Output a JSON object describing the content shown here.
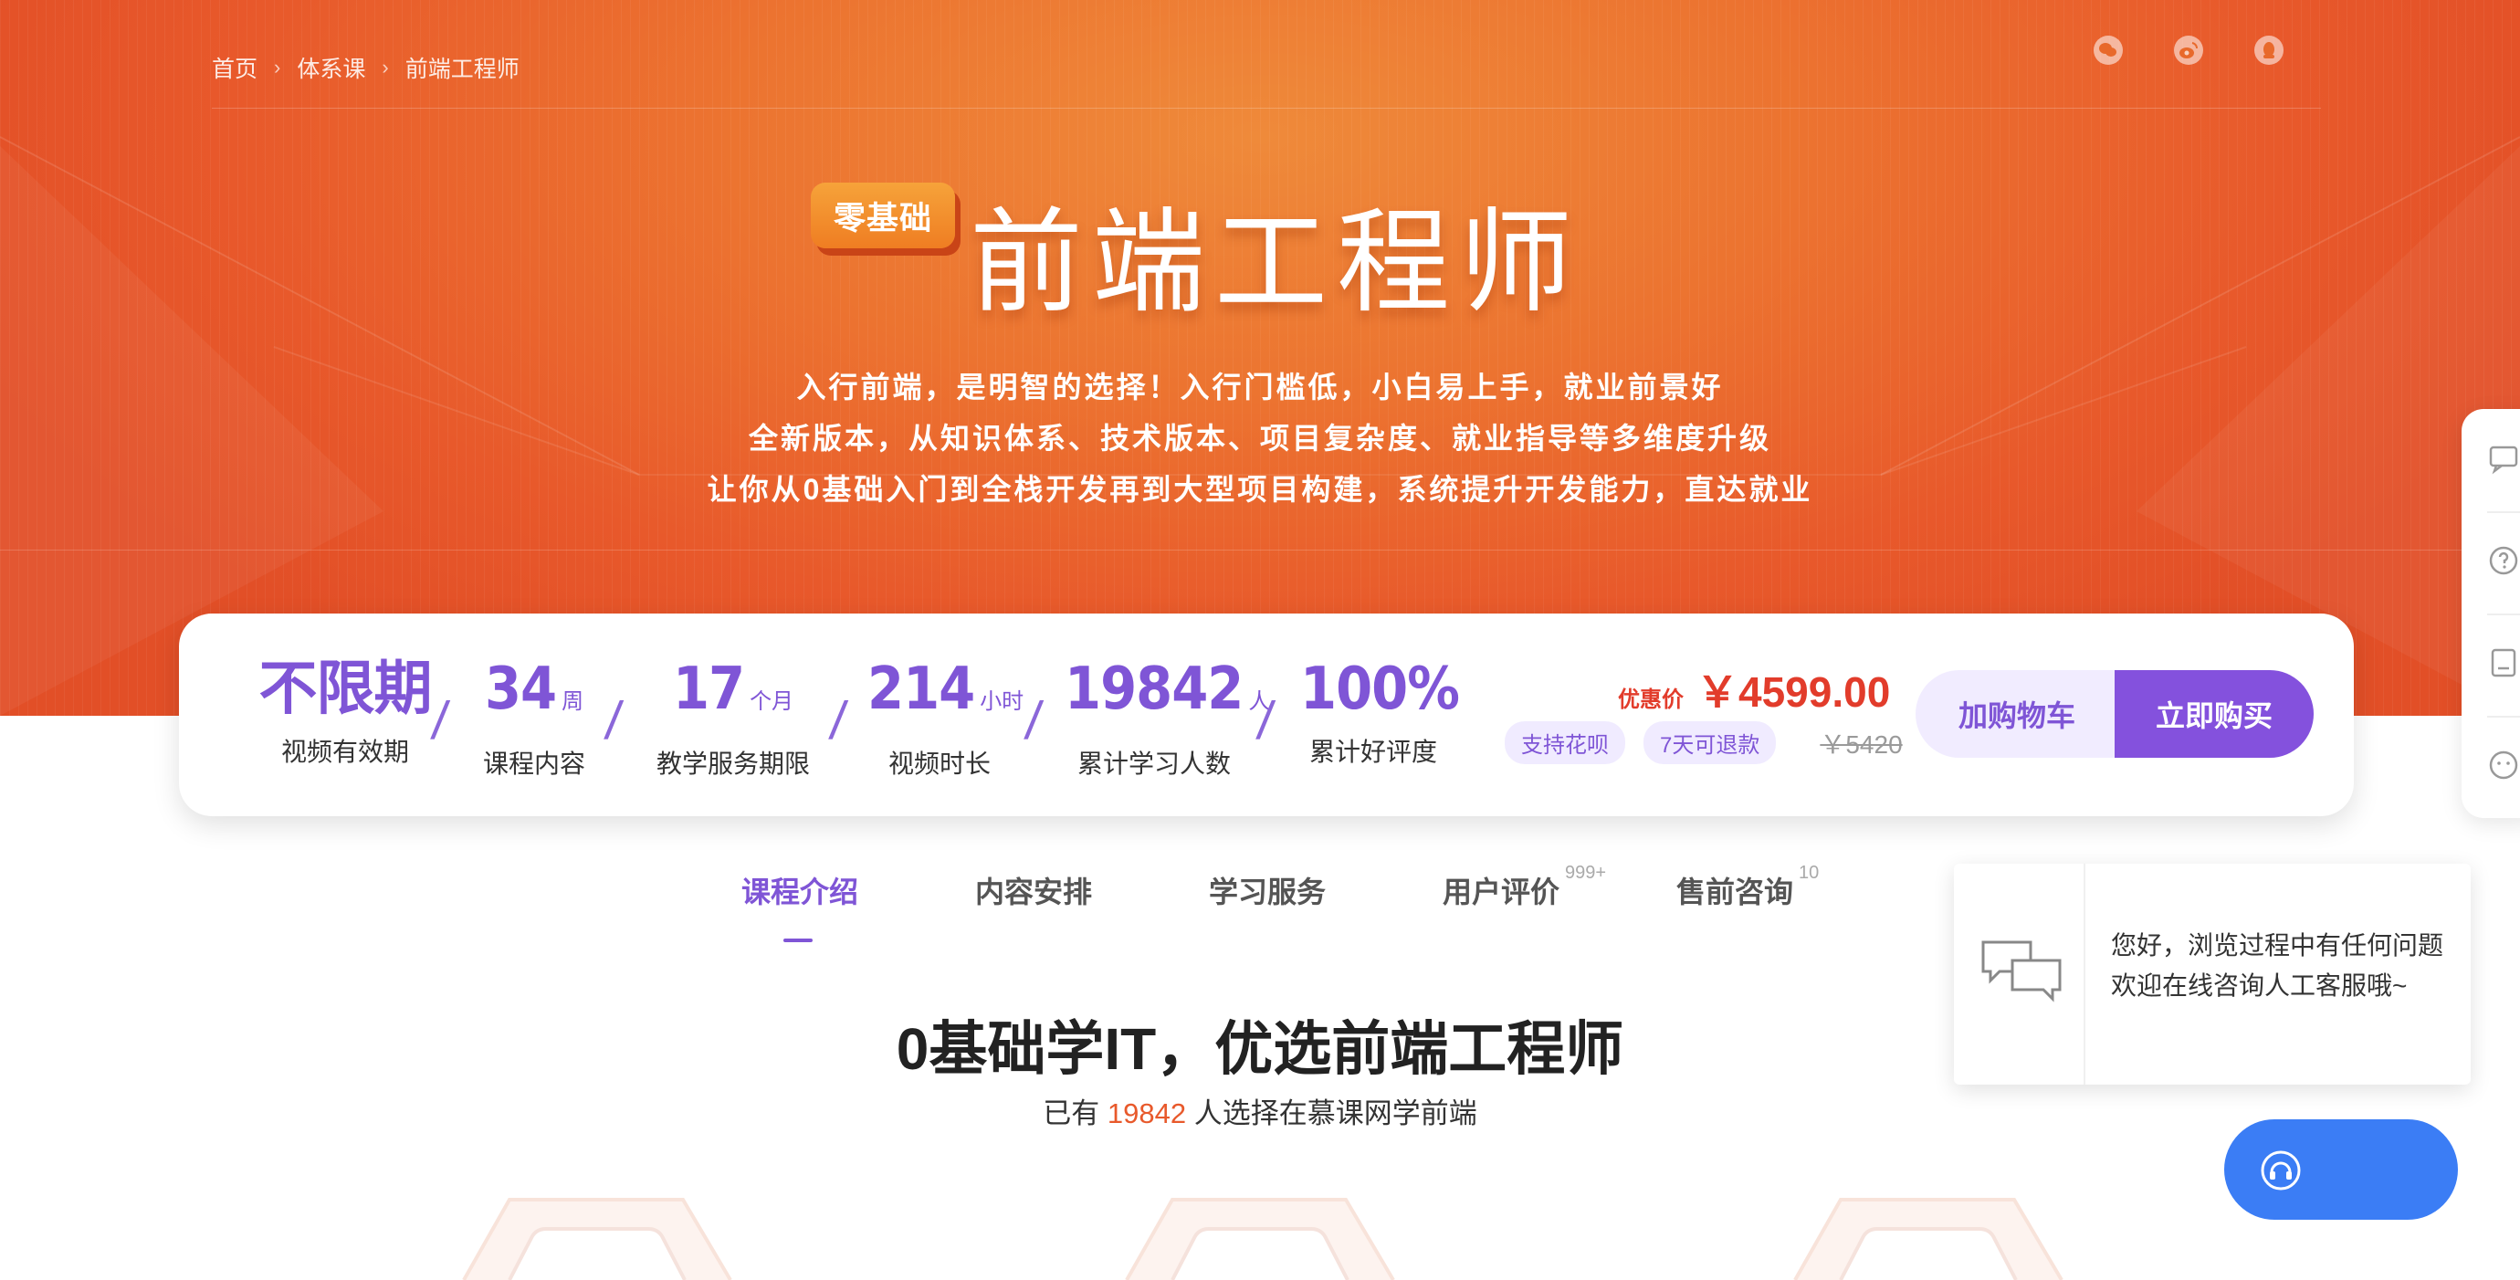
{
  "breadcrumb": {
    "items": [
      "首页",
      "体系课",
      "前端工程师"
    ],
    "separator": "›"
  },
  "hero": {
    "badge": "零基础",
    "title": "前端工程师",
    "lines": [
      "入行前端，是明智的选择！入行门槛低，小白易上手，就业前景好",
      "全新版本，从知识体系、技术版本、项目复杂度、就业指导等多维度升级",
      "让你从0基础入门到全栈开发再到大型项目构建，系统提升开发能力，直达就业"
    ]
  },
  "social_icons": [
    "wechat-icon",
    "weibo-icon",
    "qq-icon"
  ],
  "stats": [
    {
      "value": "不限期",
      "unit": "",
      "label": "视频有效期"
    },
    {
      "value": "34",
      "unit": "周",
      "label": "课程内容"
    },
    {
      "value": "17",
      "unit": "个月",
      "label": "教学服务期限"
    },
    {
      "value": "214",
      "unit": "小时",
      "label": "视频时长"
    },
    {
      "value": "19842",
      "unit": "人",
      "label": "累计学习人数"
    },
    {
      "value": "100%",
      "unit": "",
      "label": "累计好评度"
    }
  ],
  "stats_separator": "/",
  "pricing": {
    "discount_label": "优惠价",
    "price": "￥4599.00",
    "tags": [
      "支持花呗",
      "7天可退款"
    ],
    "original_price": "￥5420"
  },
  "buttons": {
    "add_cart": "加购物车",
    "buy_now": "立即购买"
  },
  "tabs": [
    {
      "label": "课程介绍",
      "badge": ""
    },
    {
      "label": "内容安排",
      "badge": ""
    },
    {
      "label": "学习服务",
      "badge": ""
    },
    {
      "label": "用户评价",
      "badge": "999+"
    },
    {
      "label": "售前咨询",
      "badge": "10"
    }
  ],
  "active_tab": "课程介绍",
  "section": {
    "title": "0基础学IT，优选前端工程师",
    "sub_prefix": "已有",
    "sub_count": "19842",
    "sub_suffix": "人选择在慕课网学前端"
  },
  "side_rail_icons": [
    "message-icon",
    "help-icon",
    "notes-icon",
    "feedback-icon"
  ],
  "chat": {
    "text": "您好，浏览过程中有任何问题欢迎在线咨询人工客服哦~",
    "icon": "chat-bubbles-icon"
  },
  "support_fab_icon": "headset-icon",
  "colors": {
    "brand_orange": "#e8592b",
    "accent_purple": "#7f55d6",
    "price_red": "#e23c2b",
    "fab_blue": "#3b7df5"
  }
}
